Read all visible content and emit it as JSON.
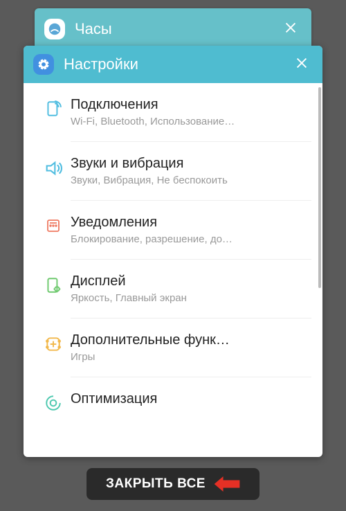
{
  "back_card": {
    "title": "Часы"
  },
  "front_card": {
    "title": "Настройки"
  },
  "settings": [
    {
      "title": "Подключения",
      "subtitle": "Wi-Fi, Bluetooth, Использование…",
      "icon": "connections"
    },
    {
      "title": "Звуки и вибрация",
      "subtitle": "Звуки, Вибрация, Не беспокоить",
      "icon": "sound"
    },
    {
      "title": "Уведомления",
      "subtitle": "Блокирование, разрешение, до…",
      "icon": "notifications"
    },
    {
      "title": "Дисплей",
      "subtitle": "Яркость, Главный экран",
      "icon": "display"
    },
    {
      "title": "Дополнительные функ…",
      "subtitle": "Игры",
      "icon": "advanced"
    },
    {
      "title": "Оптимизация",
      "subtitle": "",
      "icon": "optimize"
    }
  ],
  "close_all_label": "ЗАКРЫТЬ ВСЕ",
  "colors": {
    "connections": "#50bde0",
    "sound": "#50bde0",
    "notifications": "#ef7961",
    "display": "#6fc96f",
    "advanced": "#f2b84b",
    "optimize": "#4fc9b0"
  }
}
